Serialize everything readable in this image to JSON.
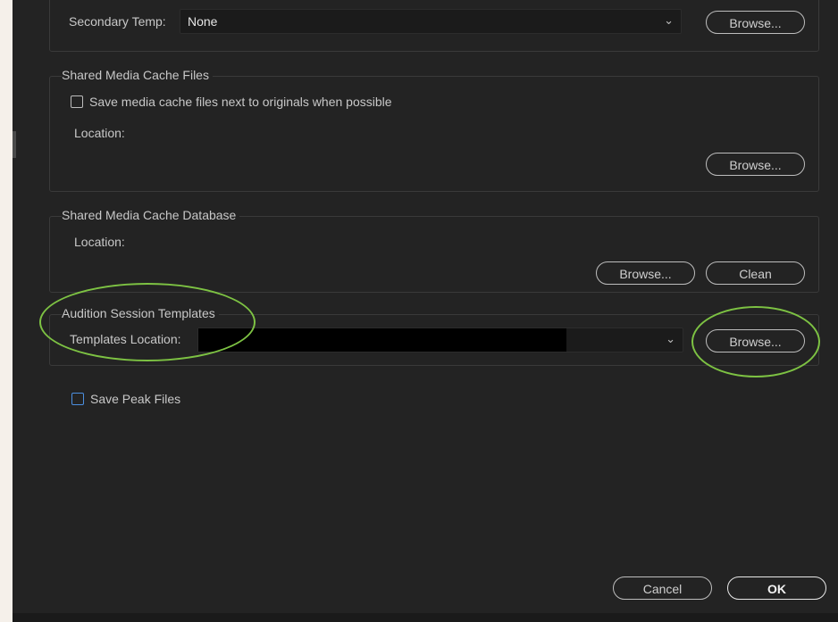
{
  "secondary_temp": {
    "label": "Secondary Temp:",
    "value": "None",
    "browse_label": "Browse..."
  },
  "shared_media_cache_files": {
    "title": "Shared Media Cache Files",
    "checkbox_label": "Save media cache files next to originals when possible",
    "checked": false,
    "location_label": "Location:",
    "browse_label": "Browse..."
  },
  "shared_media_cache_database": {
    "title": "Shared Media Cache Database",
    "location_label": "Location:",
    "browse_label": "Browse...",
    "clean_label": "Clean"
  },
  "audition_session_templates": {
    "title": "Audition Session Templates",
    "location_label": "Templates Location:",
    "browse_label": "Browse..."
  },
  "save_peak_files": {
    "label": "Save Peak Files",
    "checked": false
  },
  "footer": {
    "cancel_label": "Cancel",
    "ok_label": "OK"
  },
  "colors": {
    "dialog_bg": "#232323",
    "highlight": "#7dc243",
    "checkbox_focus": "#4c8fe0"
  },
  "icons": {
    "dropdown": "chevron-down-icon"
  }
}
